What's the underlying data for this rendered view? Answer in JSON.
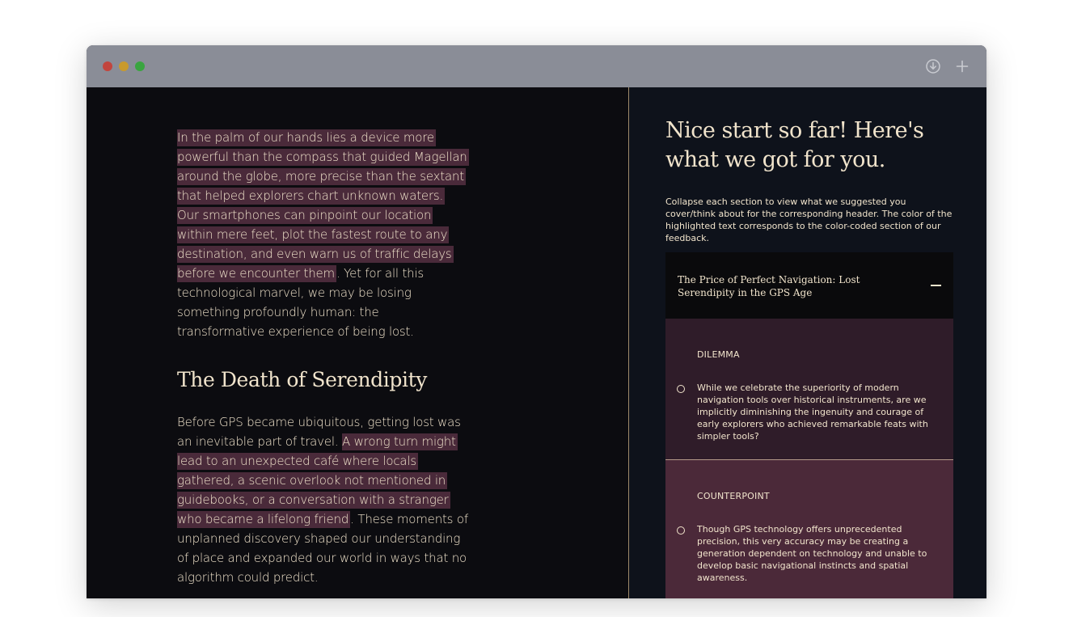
{
  "window": {
    "controls": [
      "close",
      "minimize",
      "maximize"
    ],
    "toolbar_icons": [
      "download-icon",
      "plus-icon"
    ]
  },
  "essay": {
    "paragraphs": [
      {
        "segments": [
          {
            "text": "In the palm of our hands lies a device more powerful than the compass that guided Magellan around the globe, more precise than the sextant that helped explorers chart unknown waters.",
            "highlight": true
          },
          {
            "text": " ",
            "highlight": false
          },
          {
            "text": "Our smartphones can pinpoint our location within mere feet, plot the fastest route to any destination, and even warn us of traffic delays before we encounter them",
            "highlight": true
          },
          {
            "text": ". Yet for all this technological marvel, we may be losing something profoundly human: the transformative experience of being lost.",
            "highlight": false
          }
        ]
      }
    ],
    "heading": "The Death of Serendipity",
    "paragraphs2": [
      {
        "segments": [
          {
            "text": "Before GPS became ubiquitous, getting lost was an inevitable part of travel. ",
            "highlight": false
          },
          {
            "text": "A wrong turn might lead to an unexpected café where locals gathered, a scenic overlook not mentioned in guidebooks, or a conversation with a stranger who became a lifelong friend",
            "highlight": true
          },
          {
            "text": ". These moments of unplanned discovery shaped our understanding of place and expanded our world in ways that no algorithm could predict.",
            "highlight": false
          }
        ]
      }
    ]
  },
  "feedback": {
    "title": "Nice start so far! Here's what we got for you.",
    "description": "Collapse each section to view what we suggested you cover/think about for the corresponding header. The color of the highlighted text corresponds to the color-coded section of our feedback.",
    "accordion": {
      "title": "The Price of Perfect Navigation: Lost Serendipity in the GPS Age",
      "expanded": true,
      "sections": [
        {
          "label": "DILEMMA",
          "color": "#2f1c29",
          "text": "While we celebrate the superiority of modern navigation tools over historical instruments, are we implicitly diminishing the ingenuity and courage of early explorers who achieved remarkable feats with simpler tools?"
        },
        {
          "label": "COUNTERPOINT",
          "color": "#4b2939",
          "text": "Though GPS technology offers unprecedented precision, this very accuracy may be creating a generation dependent on technology and unable to develop basic navigational instincts and spatial awareness."
        }
      ]
    }
  },
  "colors": {
    "highlight": "#4a2a3a",
    "text": "#f1e4cc",
    "left_bg": "#0c0c10",
    "right_bg": "#0e121b",
    "titlebar": "#8a8d97"
  }
}
